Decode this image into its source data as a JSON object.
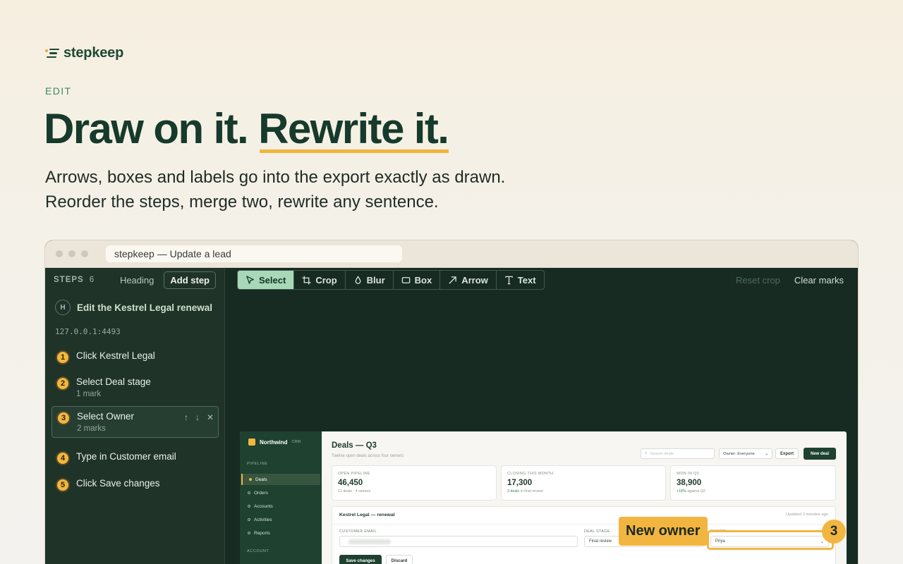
{
  "brand": {
    "name": "stepkeep"
  },
  "eyebrow": "EDIT",
  "headline": {
    "part1": "Draw on it.",
    "part2": "Rewrite it."
  },
  "subtitle": {
    "line1": "Arrows, boxes and labels go into the export exactly as drawn.",
    "line2": "Reorder the steps, merge two, rewrite any sentence."
  },
  "window": {
    "title": "stepkeep — Update a lead"
  },
  "colors": {
    "accent": "#f2b640",
    "brand_green": "#1e4130",
    "editor_bg": "#172b22",
    "tool_active": "#a8d8b8"
  },
  "sidebar": {
    "steps_label": "STEPS",
    "steps_count": "6",
    "heading_btn": "Heading",
    "add_step_btn": "Add step",
    "heading": {
      "badge": "H",
      "title": "Edit the Kestrel Legal renewal"
    },
    "url": "127.0.0.1:4493",
    "steps": [
      {
        "num": "1",
        "label": "Click Kestrel Legal",
        "meta": ""
      },
      {
        "num": "2",
        "label": "Select Deal stage",
        "meta": "1 mark"
      },
      {
        "num": "3",
        "label": "Select Owner",
        "meta": "2 marks",
        "active": true
      },
      {
        "num": "4",
        "label": "Type in Customer email",
        "meta": ""
      },
      {
        "num": "5",
        "label": "Click Save changes",
        "meta": ""
      }
    ],
    "step_controls": {
      "up": "↑",
      "down": "↓",
      "remove": "✕"
    }
  },
  "toolbar": {
    "tools": [
      {
        "label": "Select",
        "icon": "pointer-icon",
        "active": true
      },
      {
        "label": "Crop",
        "icon": "crop-icon"
      },
      {
        "label": "Blur",
        "icon": "drop-icon"
      },
      {
        "label": "Box",
        "icon": "box-icon"
      },
      {
        "label": "Arrow",
        "icon": "arrow-icon"
      },
      {
        "label": "Text",
        "icon": "text-icon"
      }
    ],
    "reset_crop": "Reset crop",
    "clear_marks": "Clear marks"
  },
  "screenshot": {
    "brand": "Northwind",
    "brand_tag": "CRM",
    "nav_section_pipeline": "PIPELINE",
    "nav_items": [
      "Deals",
      "Orders",
      "Accounts",
      "Activities",
      "Reports"
    ],
    "nav_section_account": "ACCOUNT",
    "title": "Deals — Q3",
    "subtitle": "Twelve open deals across four owners",
    "search_placeholder": "Search deals",
    "owner_filter": "Owner: Everyone",
    "export_btn": "Export",
    "new_deal_btn": "New deal",
    "kpis": [
      {
        "label": "OPEN PIPELINE",
        "value": "46,450",
        "sub": "12 deals · 4 owners",
        "sub_highlight": ""
      },
      {
        "label": "CLOSING THIS MONTH",
        "value": "17,300",
        "sub": "in final review",
        "sub_highlight": "3 deals"
      },
      {
        "label": "WON IN Q3",
        "value": "38,900",
        "sub": "against Q2",
        "sub_highlight": "+18%"
      }
    ],
    "record_title": "Kestrel Legal — renewal",
    "record_updated": "Updated 2 minutes ago",
    "customer_email_label": "CUSTOMER EMAIL",
    "deal_stage_label": "DEAL STAGE",
    "deal_stage_value": "Final review",
    "owner_label": "OWNER",
    "owner_value": "Priya",
    "save_btn": "Save changes",
    "discard_btn": "Discard"
  },
  "annotation": {
    "label": "New owner",
    "number": "3"
  }
}
